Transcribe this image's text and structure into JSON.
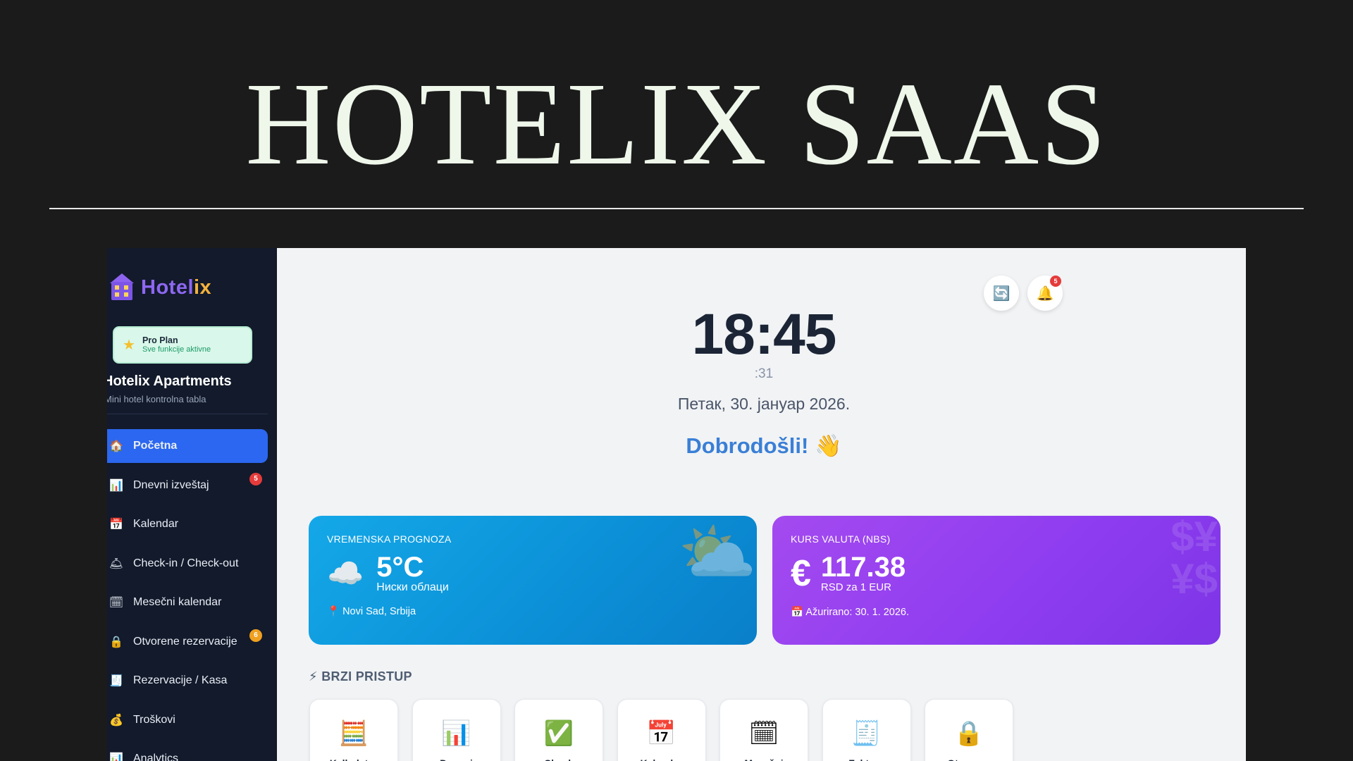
{
  "promo": {
    "title": "HOTELIX SAAS"
  },
  "sidebar": {
    "logo": {
      "part1": "Hotel",
      "part2": "ix",
      "icon": "hotel-icon"
    },
    "plan": {
      "name": "Pro Plan",
      "subtitle": "Sve funkcije aktivne",
      "icon": "star-icon"
    },
    "brand_name": "Hotelix Apartments",
    "brand_sub": "Mini hotel kontrolna tabla",
    "items": [
      {
        "label": "Početna",
        "icon": "🏠",
        "icon_name": "home-icon",
        "active": true
      },
      {
        "label": "Dnevni izveštaj",
        "icon": "📊",
        "icon_name": "bar-chart-icon",
        "badge": "5",
        "badge_color": "#e53b3b"
      },
      {
        "label": "Kalendar",
        "icon": "📅",
        "icon_name": "calendar-icon"
      },
      {
        "label": "Check-in / Check-out",
        "icon": "🛎",
        "icon_name": "door-icon"
      },
      {
        "label": "Mesečni kalendar",
        "icon": "🗓",
        "icon_name": "monthly-calendar-icon"
      },
      {
        "label": "Otvorene rezervacije",
        "icon": "🔒",
        "icon_name": "lock-icon",
        "badge": "6",
        "badge_color": "#f0a020"
      },
      {
        "label": "Rezervacije / Kasa",
        "icon": "🧾",
        "icon_name": "receipt-icon"
      },
      {
        "label": "Troškovi",
        "icon": "💰",
        "icon_name": "money-bag-icon"
      },
      {
        "label": "Analytics",
        "icon": "📊",
        "icon_name": "analytics-icon"
      }
    ]
  },
  "header": {
    "notifications_count": "5"
  },
  "clock": {
    "time": "18:45",
    "seconds": ":31",
    "date": "Петак, 30. јануар 2026.",
    "welcome": "Dobrodošli! 👋"
  },
  "weather": {
    "label": "VREMENSKA PROGNOZA",
    "icon": "☁️",
    "temperature": "5°C",
    "description": "Ниски облаци",
    "location": "📍 Novi Sad, Srbija"
  },
  "currency": {
    "label": "KURS VALUTA (NBS)",
    "symbol": "€",
    "rate": "117.38",
    "unit": "RSD za 1 EUR",
    "updated": "📅 Ažurirano: 30. 1. 2026."
  },
  "quick_access": {
    "title": "⚡ BRZI PRISTUP",
    "items": [
      {
        "label": "Kalkulator",
        "icon": "🧮",
        "icon_name": "abacus-icon"
      },
      {
        "label": "Dnevni",
        "icon": "📊",
        "icon_name": "bar-chart-icon"
      },
      {
        "label": "Check",
        "icon": "✅",
        "icon_name": "checkmark-icon"
      },
      {
        "label": "Kalendar",
        "icon": "📅",
        "icon_name": "calendar-icon"
      },
      {
        "label": "Mesečni",
        "icon": "🗓",
        "icon_name": "monthly-calendar-icon"
      },
      {
        "label": "Faktura",
        "icon": "🧾",
        "icon_name": "receipt-icon"
      },
      {
        "label": "Otvorene",
        "icon": "🔒",
        "icon_name": "lock-icon"
      }
    ]
  },
  "colors": {
    "sidebar_bg": "#121a2b",
    "active_nav": "#2b67f0",
    "weather_card": "#0ea0e6",
    "currency_card": "#9140f0",
    "welcome_text": "#3a7fd6"
  }
}
